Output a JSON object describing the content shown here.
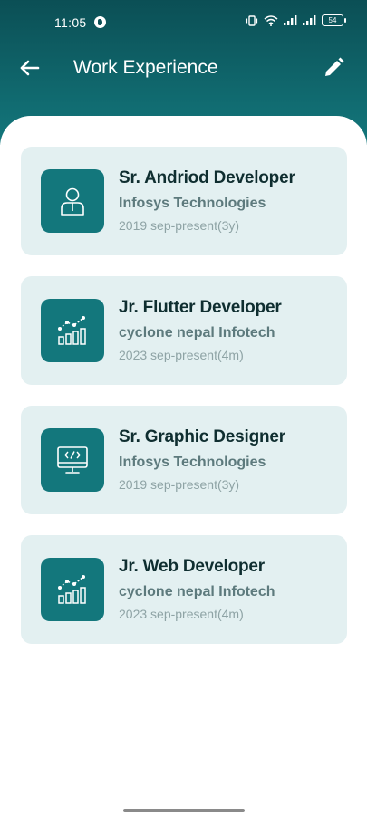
{
  "status_bar": {
    "time": "11:05",
    "battery": "54"
  },
  "app_bar": {
    "title": "Work Experience",
    "back_icon": "arrow-left-icon",
    "edit_icon": "pencil-icon"
  },
  "experiences": [
    {
      "title": "Sr. Andriod Developer",
      "company": "Infosys Technologies",
      "period": "2019 sep-present(3y)",
      "icon": "person-icon"
    },
    {
      "title": "Jr. Flutter Developer",
      "company": "cyclone nepal Infotech",
      "period": "2023 sep-present(4m)",
      "icon": "growth-chart-icon"
    },
    {
      "title": "Sr. Graphic Designer",
      "company": "Infosys Technologies",
      "period": "2019 sep-present(3y)",
      "icon": "monitor-code-icon"
    },
    {
      "title": "Jr. Web Developer",
      "company": "cyclone nepal Infotech",
      "period": "2023 sep-present(4m)",
      "icon": "growth-chart-icon"
    }
  ],
  "colors": {
    "header_dark": "#0b4f55",
    "header_light": "#13777c",
    "card_bg": "#e3f0f1",
    "icon_bg": "#13777c"
  }
}
